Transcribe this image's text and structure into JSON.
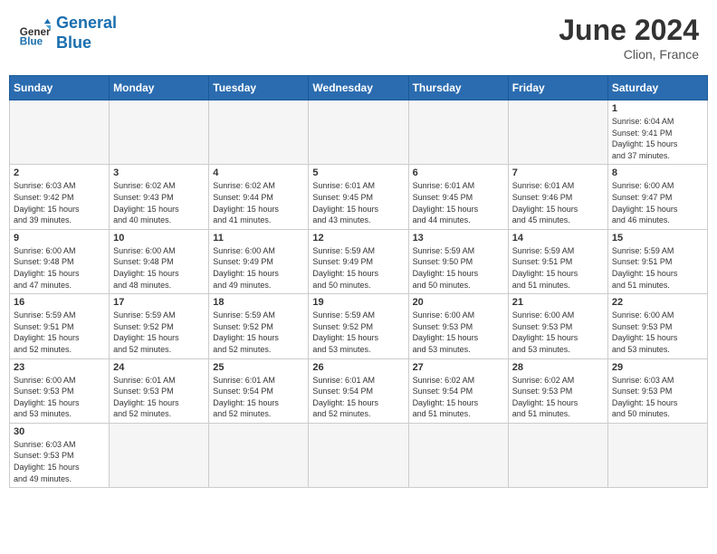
{
  "header": {
    "logo_general": "General",
    "logo_blue": "Blue",
    "month": "June 2024",
    "location": "Clion, France"
  },
  "weekdays": [
    "Sunday",
    "Monday",
    "Tuesday",
    "Wednesday",
    "Thursday",
    "Friday",
    "Saturday"
  ],
  "days": {
    "1": {
      "sunrise": "6:04 AM",
      "sunset": "9:41 PM",
      "hours": "15",
      "minutes": "37"
    },
    "2": {
      "sunrise": "6:03 AM",
      "sunset": "9:42 PM",
      "hours": "15",
      "minutes": "39"
    },
    "3": {
      "sunrise": "6:02 AM",
      "sunset": "9:43 PM",
      "hours": "15",
      "minutes": "40"
    },
    "4": {
      "sunrise": "6:02 AM",
      "sunset": "9:44 PM",
      "hours": "15",
      "minutes": "41"
    },
    "5": {
      "sunrise": "6:01 AM",
      "sunset": "9:45 PM",
      "hours": "15",
      "minutes": "43"
    },
    "6": {
      "sunrise": "6:01 AM",
      "sunset": "9:45 PM",
      "hours": "15",
      "minutes": "44"
    },
    "7": {
      "sunrise": "6:01 AM",
      "sunset": "9:46 PM",
      "hours": "15",
      "minutes": "45"
    },
    "8": {
      "sunrise": "6:00 AM",
      "sunset": "9:47 PM",
      "hours": "15",
      "minutes": "46"
    },
    "9": {
      "sunrise": "6:00 AM",
      "sunset": "9:48 PM",
      "hours": "15",
      "minutes": "47"
    },
    "10": {
      "sunrise": "6:00 AM",
      "sunset": "9:48 PM",
      "hours": "15",
      "minutes": "48"
    },
    "11": {
      "sunrise": "6:00 AM",
      "sunset": "9:49 PM",
      "hours": "15",
      "minutes": "49"
    },
    "12": {
      "sunrise": "5:59 AM",
      "sunset": "9:49 PM",
      "hours": "15",
      "minutes": "50"
    },
    "13": {
      "sunrise": "5:59 AM",
      "sunset": "9:50 PM",
      "hours": "15",
      "minutes": "50"
    },
    "14": {
      "sunrise": "5:59 AM",
      "sunset": "9:51 PM",
      "hours": "15",
      "minutes": "51"
    },
    "15": {
      "sunrise": "5:59 AM",
      "sunset": "9:51 PM",
      "hours": "15",
      "minutes": "51"
    },
    "16": {
      "sunrise": "5:59 AM",
      "sunset": "9:51 PM",
      "hours": "15",
      "minutes": "52"
    },
    "17": {
      "sunrise": "5:59 AM",
      "sunset": "9:52 PM",
      "hours": "15",
      "minutes": "52"
    },
    "18": {
      "sunrise": "5:59 AM",
      "sunset": "9:52 PM",
      "hours": "15",
      "minutes": "52"
    },
    "19": {
      "sunrise": "5:59 AM",
      "sunset": "9:52 PM",
      "hours": "15",
      "minutes": "53"
    },
    "20": {
      "sunrise": "6:00 AM",
      "sunset": "9:53 PM",
      "hours": "15",
      "minutes": "53"
    },
    "21": {
      "sunrise": "6:00 AM",
      "sunset": "9:53 PM",
      "hours": "15",
      "minutes": "53"
    },
    "22": {
      "sunrise": "6:00 AM",
      "sunset": "9:53 PM",
      "hours": "15",
      "minutes": "53"
    },
    "23": {
      "sunrise": "6:00 AM",
      "sunset": "9:53 PM",
      "hours": "15",
      "minutes": "53"
    },
    "24": {
      "sunrise": "6:01 AM",
      "sunset": "9:53 PM",
      "hours": "15",
      "minutes": "52"
    },
    "25": {
      "sunrise": "6:01 AM",
      "sunset": "9:54 PM",
      "hours": "15",
      "minutes": "52"
    },
    "26": {
      "sunrise": "6:01 AM",
      "sunset": "9:54 PM",
      "hours": "15",
      "minutes": "52"
    },
    "27": {
      "sunrise": "6:02 AM",
      "sunset": "9:54 PM",
      "hours": "15",
      "minutes": "51"
    },
    "28": {
      "sunrise": "6:02 AM",
      "sunset": "9:53 PM",
      "hours": "15",
      "minutes": "51"
    },
    "29": {
      "sunrise": "6:03 AM",
      "sunset": "9:53 PM",
      "hours": "15",
      "minutes": "50"
    },
    "30": {
      "sunrise": "6:03 AM",
      "sunset": "9:53 PM",
      "hours": "15",
      "minutes": "49"
    }
  }
}
